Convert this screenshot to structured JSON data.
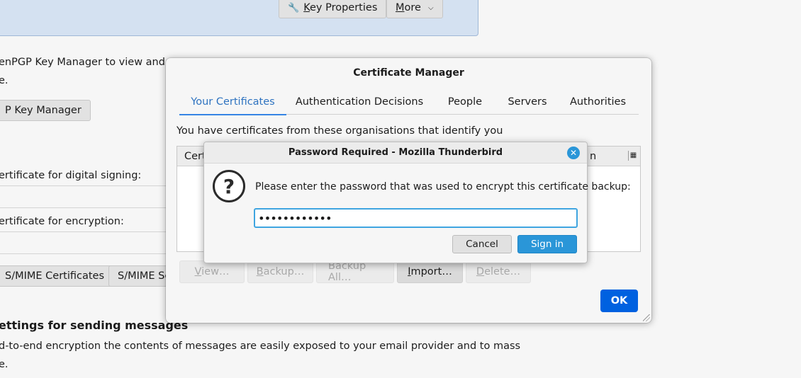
{
  "background": {
    "key_properties_label": "Key Properties",
    "more_label": "More",
    "openpgp_line1": "enPGP Key Manager to view and ma",
    "openpgp_line2": "e.",
    "key_manager_label": "P Key Manager",
    "signing_label": "ertificate for digital signing:",
    "encryption_label": "ertificate for encryption:",
    "smime_certificates_label": "S/MIME Certificates",
    "smime_security_label": "S/MIME Se",
    "sending_heading": "ettings for sending messages",
    "e2e_line1": "d-to-end encryption the contents of messages are easily exposed to your email provider and to mass",
    "e2e_line2": "e."
  },
  "cert_manager": {
    "title": "Certificate Manager",
    "tabs": [
      {
        "label": "Your Certificates",
        "active": true
      },
      {
        "label": "Authentication Decisions",
        "active": false
      },
      {
        "label": "People",
        "active": false
      },
      {
        "label": "Servers",
        "active": false
      },
      {
        "label": "Authorities",
        "active": false
      }
    ],
    "description": "You have certificates from these organisations that identify you",
    "column_left": "Cert",
    "column_right": "n",
    "actions": [
      {
        "label": "View…",
        "enabled": false
      },
      {
        "label": "Backup…",
        "enabled": false
      },
      {
        "label": "Backup All…",
        "enabled": false
      },
      {
        "label": "Import…",
        "enabled": true
      },
      {
        "label": "Delete…",
        "enabled": false
      }
    ],
    "ok_label": "OK"
  },
  "password_dialog": {
    "title": "Password Required - Mozilla Thunderbird",
    "message": "Please enter the password that was used to encrypt this certificate backup:",
    "password_value": "••••••••••••",
    "cancel_label": "Cancel",
    "signin_label": "Sign in",
    "close_glyph": "✕",
    "question_glyph": "?"
  },
  "colors": {
    "accent": "#3584e4",
    "ok_button": "#0061e0",
    "signin_button": "#2a96d8"
  }
}
